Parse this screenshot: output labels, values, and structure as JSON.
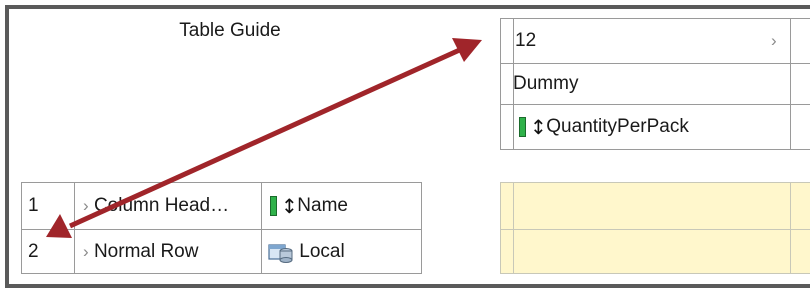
{
  "guide": {
    "title": "Table Guide",
    "rows": [
      {
        "index": "1",
        "type": "Column Head…",
        "value": "Name",
        "icon": "column-icon"
      },
      {
        "index": "2",
        "type": "Normal Row",
        "value": "Local",
        "icon": "local-datasource-icon"
      }
    ]
  },
  "table": {
    "page_value": "12",
    "header_label": "Dummy",
    "column_label": "QuantityPerPack"
  },
  "colors": {
    "arrow": "#a0252a",
    "highlight_row": "#fff7cc",
    "column_bar": "#2fb24a"
  }
}
